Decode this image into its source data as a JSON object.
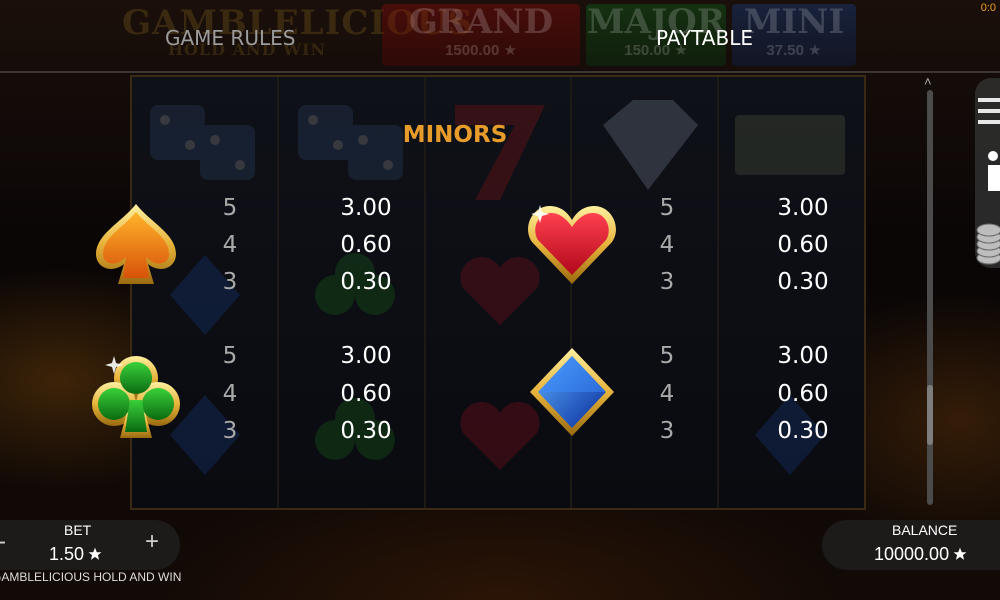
{
  "background": {
    "logo_line1": "GAMBLELICIOUS",
    "logo_line2": "HOLD AND WIN",
    "jackpots": [
      {
        "name": "GRAND",
        "amount": "1500.00"
      },
      {
        "name": "MAJOR",
        "amount": "150.00"
      },
      {
        "name": "MINI",
        "amount": "37.50"
      }
    ]
  },
  "tabs": [
    {
      "label": "GAME RULES",
      "active": false
    },
    {
      "label": "PAYTABLE",
      "active": true
    }
  ],
  "clock": "0:0",
  "paytable": {
    "heading": "MINORS",
    "symbols": [
      {
        "icon": "spade-icon",
        "color": "#f07a10",
        "payouts": [
          {
            "count": "5",
            "value": "3.00"
          },
          {
            "count": "4",
            "value": "0.60"
          },
          {
            "count": "3",
            "value": "0.30"
          }
        ]
      },
      {
        "icon": "heart-icon",
        "color": "#d5102a",
        "payouts": [
          {
            "count": "5",
            "value": "3.00"
          },
          {
            "count": "4",
            "value": "0.60"
          },
          {
            "count": "3",
            "value": "0.30"
          }
        ]
      },
      {
        "icon": "club-icon",
        "color": "#1a8a1a",
        "payouts": [
          {
            "count": "5",
            "value": "3.00"
          },
          {
            "count": "4",
            "value": "0.60"
          },
          {
            "count": "3",
            "value": "0.30"
          }
        ]
      },
      {
        "icon": "diamond-icon",
        "color": "#1a5ad8",
        "payouts": [
          {
            "count": "5",
            "value": "3.00"
          },
          {
            "count": "4",
            "value": "0.60"
          },
          {
            "count": "3",
            "value": "0.30"
          }
        ]
      }
    ]
  },
  "side_icons": [
    "menu-icon",
    "info-icon",
    "coins-icon"
  ],
  "bet": {
    "label": "BET",
    "value": "1.50",
    "minus": "-",
    "plus": "+"
  },
  "game_name": "GAMBLELICIOUS HOLD AND WIN",
  "balance": {
    "label": "BALANCE",
    "value": "10000.00"
  },
  "colors": {
    "heading": "#e79b2b",
    "count_text": "#a9a9a9",
    "gold": "#e7b33a"
  }
}
